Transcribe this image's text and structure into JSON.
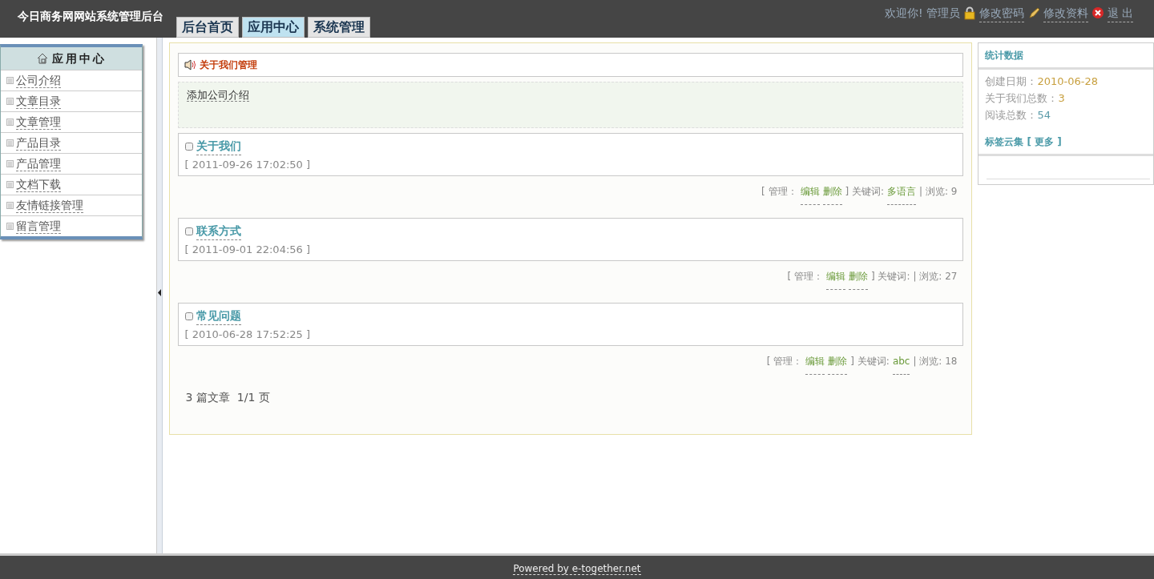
{
  "header": {
    "title": "今日商务网网站系统管理后台",
    "tabs": [
      {
        "label": "后台首页",
        "selected": false
      },
      {
        "label": "应用中心",
        "selected": true
      },
      {
        "label": "系统管理",
        "selected": false
      }
    ],
    "welcome": "欢迎你!",
    "user": "管理员",
    "links": [
      {
        "label": "修改密码",
        "kind": "lock"
      },
      {
        "label": "修改资料",
        "kind": "pencil"
      },
      {
        "label": "退 出",
        "kind": "exit"
      }
    ]
  },
  "sidebar": {
    "title": "应用中心",
    "items": [
      "公司介绍",
      "文章目录",
      "文章管理",
      "产品目录",
      "产品管理",
      "文档下载",
      "友情链接管理",
      "留言管理"
    ]
  },
  "main": {
    "heading": "关于我们管理",
    "add_link": "添加公司介绍",
    "articles": [
      {
        "title": "关于我们",
        "date": "[ 2011-09-26 17:02:50 ]",
        "manage_label": "[ 管理：",
        "edit": "编辑",
        "delete": "删除",
        "keyword_label": "] 关键词:",
        "keyword": "多语言",
        "views": "| 浏览: 9"
      },
      {
        "title": "联系方式",
        "date": "[ 2011-09-01 22:04:56 ]",
        "manage_label": "[ 管理：",
        "edit": "编辑",
        "delete": "删除",
        "keyword_label": "] 关键词:",
        "views": "| 浏览: 27"
      },
      {
        "title": "常见问题",
        "date": "[ 2010-06-28 17:52:25 ]",
        "manage_label": "[ 管理：",
        "edit": "编辑",
        "delete": "删除",
        "keyword_label": "] 关键词:",
        "keyword": "abc",
        "views": "| 浏览: 18"
      }
    ],
    "pager": "3 篇文章  1/1 页"
  },
  "stats": {
    "title": "统计数据",
    "rows": [
      {
        "label": "创建日期：",
        "value": "2010-06-28",
        "color": "#c8a040"
      },
      {
        "label": "关于我们总数：",
        "value": "3",
        "color": "#c8a040"
      },
      {
        "label": "阅读总数：",
        "value": "54",
        "color": "#5a9aa8"
      }
    ],
    "tags_title": "标签云集",
    "more": "[ 更多 ]"
  },
  "footer": "Powered by e-together.net"
}
